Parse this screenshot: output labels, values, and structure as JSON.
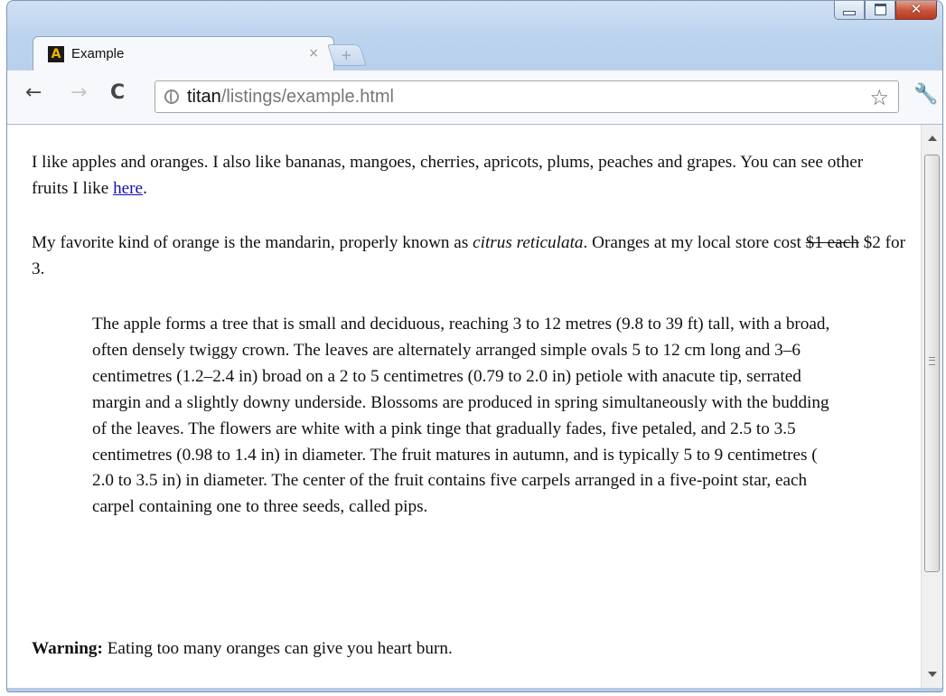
{
  "window": {
    "buttons": {
      "minimize": "minimize",
      "maximize": "maximize",
      "close": "✕"
    }
  },
  "tab": {
    "title": "Example",
    "favicon_letter": "A",
    "close_glyph": "×",
    "new_tab_glyph": "+"
  },
  "toolbar": {
    "back": "←",
    "forward": "→",
    "reload": "C",
    "url_host": "titan",
    "url_path": "/listings/example.html",
    "star": "☆",
    "wrench": "🔧"
  },
  "content": {
    "p1_text": "I like apples and oranges. I also like bananas, mangoes, cherries, apricots, plums, peaches and grapes. You can see other fruits I like ",
    "p1_link": "here",
    "p1_end": ".",
    "p2_start": "My favorite kind of orange is the mandarin, properly known as ",
    "p2_italic": "citrus reticulata",
    "p2_middle": ". Oranges at my local store cost ",
    "p2_strike": "$1 each",
    "p2_end": " $2 for 3.",
    "blockquote": "The apple forms a tree that is small and deciduous, reaching 3 to 12 metres (9.8 to 39 ft) tall, with a broad, often densely twiggy crown. The leaves are alternately arranged simple ovals 5 to 12 cm long and 3–6 centimetres (1.2–2.4 in) broad on a 2 to 5 centimetres (0.79 to 2.0 in) petiole with anacute tip, serrated margin and a slightly downy underside. Blossoms are produced in spring simultaneously with the budding of the leaves. The flowers are white with a pink tinge that gradually fades, five petaled, and 2.5 to 3.5 centimetres (0.98 to 1.4 in) in diameter. The fruit matures in autumn, and is typically 5 to 9 centimetres ( 2.0 to 3.5 in) in diameter. The center of the fruit contains five carpels arranged in a five-point star, each carpel containing one to three seeds, called pips.",
    "warning_label": "Warning:",
    "warning_text": " Eating too many oranges can give you heart burn."
  },
  "colors": {
    "link": "#1a0dab",
    "chrome_frame": "#bcd3ee",
    "close_button": "#c8553d"
  }
}
